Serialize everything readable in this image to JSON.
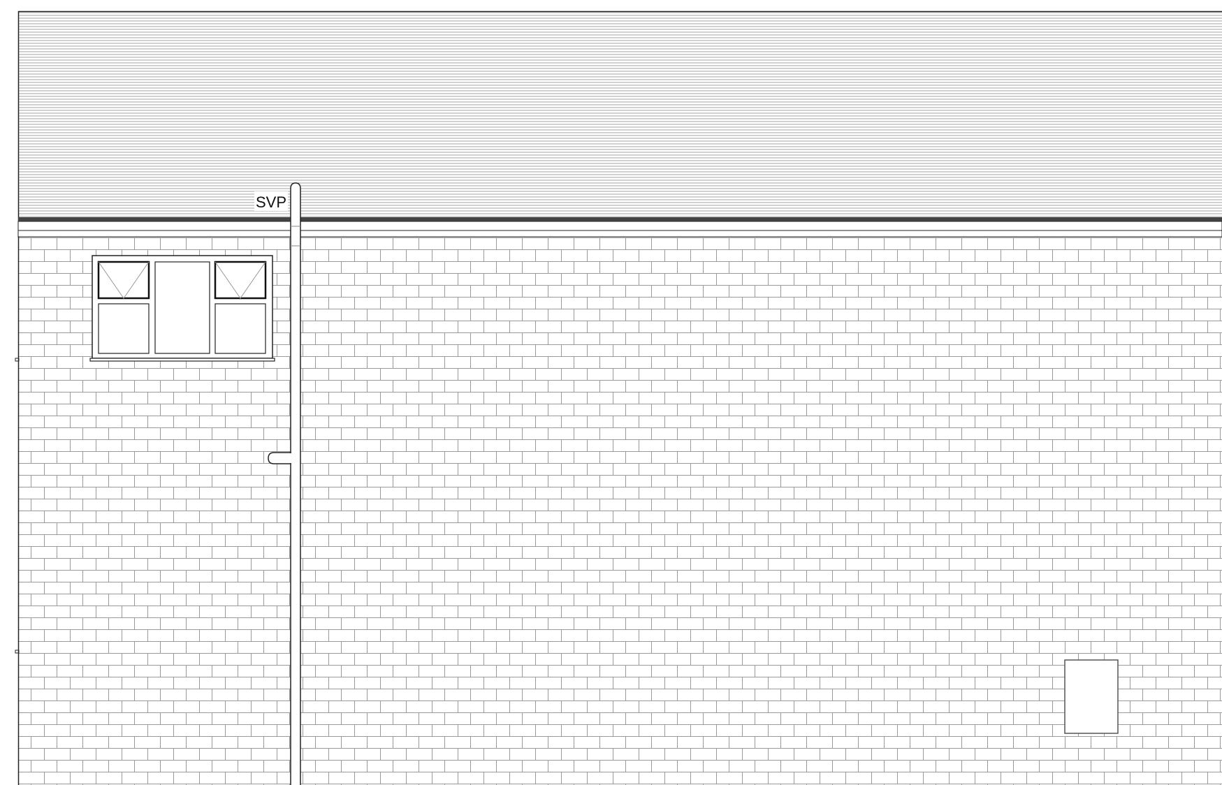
{
  "drawing": {
    "labels": {
      "svp": "SVP"
    },
    "colors": {
      "background": "#ffffff",
      "line": "#222222",
      "roof_hatch": "#8c8c8c",
      "brick_joint": "#9a9a9a",
      "eaves_band": "#444444"
    },
    "window": {
      "casement_panes": 4,
      "fixed_panes": 1,
      "top_openers": 2
    }
  }
}
